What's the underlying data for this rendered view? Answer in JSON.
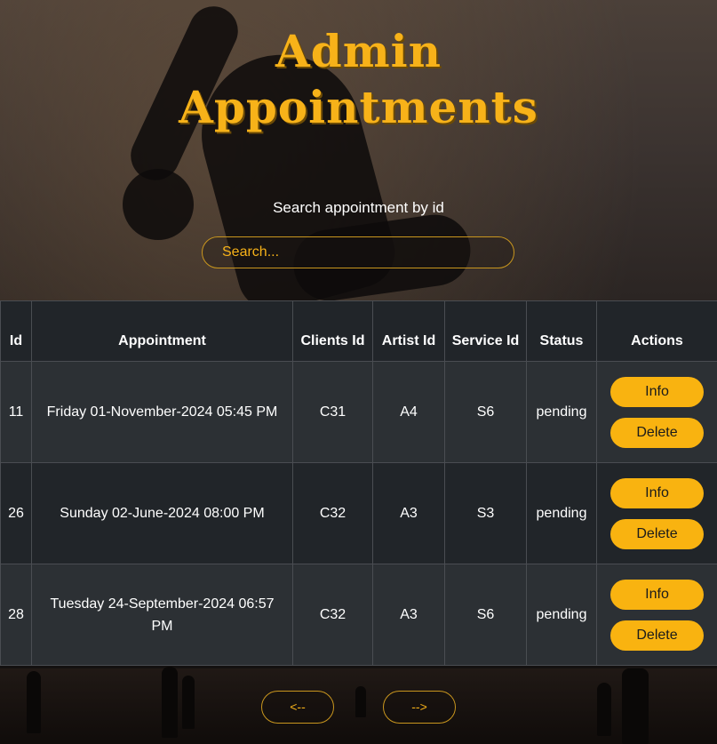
{
  "header": {
    "title_line1": "Admin",
    "title_line2": "Appointments"
  },
  "search": {
    "label": "Search appointment by id",
    "placeholder": "Search..."
  },
  "table": {
    "columns": [
      "Id",
      "Appointment",
      "Clients Id",
      "Artist Id",
      "Service Id",
      "Status",
      "Actions"
    ],
    "rows": [
      {
        "id": "11",
        "appointment": "Friday 01-November-2024 05:45 PM",
        "client": "C31",
        "artist": "A4",
        "service": "S6",
        "status": "pending"
      },
      {
        "id": "26",
        "appointment": "Sunday 02-June-2024 08:00 PM",
        "client": "C32",
        "artist": "A3",
        "service": "S3",
        "status": "pending"
      },
      {
        "id": "28",
        "appointment": "Tuesday 24-September-2024 06:57 PM",
        "client": "C32",
        "artist": "A3",
        "service": "S6",
        "status": "pending"
      }
    ],
    "info_label": "Info",
    "delete_label": "Delete"
  },
  "pagination": {
    "prev_label": "<--",
    "next_label": "-->"
  },
  "colors": {
    "accent": "#f9b310",
    "table_dark": "#212529",
    "table_stripe": "#2c3034"
  }
}
